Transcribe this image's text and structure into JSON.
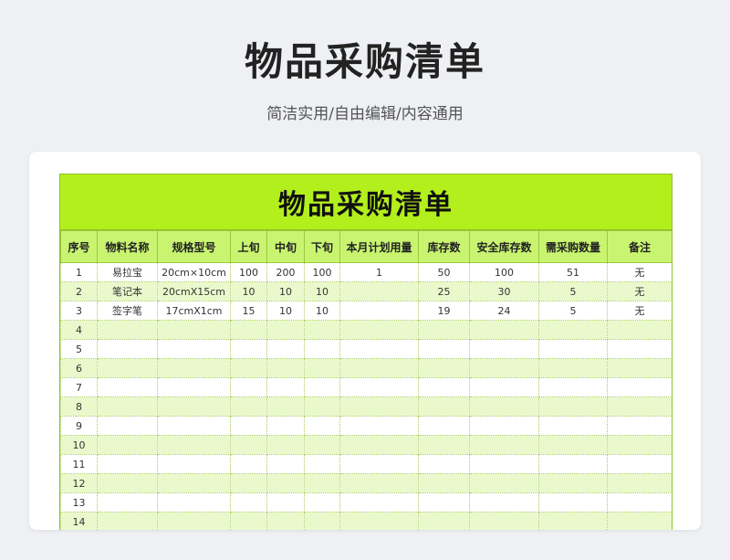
{
  "header": {
    "title": "物品采购清单",
    "subtitle": "简洁实用/自由编辑/内容通用"
  },
  "sheet": {
    "title": "物品采购清单",
    "columns": [
      "序号",
      "物料名称",
      "规格型号",
      "上旬",
      "中旬",
      "下旬",
      "本月计划用量",
      "库存数",
      "安全库存数",
      "需采购数量",
      "备注"
    ],
    "rows": [
      [
        "1",
        "易拉宝",
        "20cm×10cm",
        "100",
        "200",
        "100",
        "1",
        "50",
        "100",
        "51",
        "无"
      ],
      [
        "2",
        "笔记本",
        "20cmX15cm",
        "10",
        "10",
        "10",
        "",
        "25",
        "30",
        "5",
        "无"
      ],
      [
        "3",
        "签字笔",
        "17cmX1cm",
        "15",
        "10",
        "10",
        "",
        "19",
        "24",
        "5",
        "无"
      ],
      [
        "4",
        "",
        "",
        "",
        "",
        "",
        "",
        "",
        "",
        "",
        ""
      ],
      [
        "5",
        "",
        "",
        "",
        "",
        "",
        "",
        "",
        "",
        "",
        ""
      ],
      [
        "6",
        "",
        "",
        "",
        "",
        "",
        "",
        "",
        "",
        "",
        ""
      ],
      [
        "7",
        "",
        "",
        "",
        "",
        "",
        "",
        "",
        "",
        "",
        ""
      ],
      [
        "8",
        "",
        "",
        "",
        "",
        "",
        "",
        "",
        "",
        "",
        ""
      ],
      [
        "9",
        "",
        "",
        "",
        "",
        "",
        "",
        "",
        "",
        "",
        ""
      ],
      [
        "10",
        "",
        "",
        "",
        "",
        "",
        "",
        "",
        "",
        "",
        ""
      ],
      [
        "11",
        "",
        "",
        "",
        "",
        "",
        "",
        "",
        "",
        "",
        ""
      ],
      [
        "12",
        "",
        "",
        "",
        "",
        "",
        "",
        "",
        "",
        "",
        ""
      ],
      [
        "13",
        "",
        "",
        "",
        "",
        "",
        "",
        "",
        "",
        "",
        ""
      ],
      [
        "14",
        "",
        "",
        "",
        "",
        "",
        "",
        "",
        "",
        "",
        ""
      ]
    ]
  },
  "colors": {
    "title_band": "#b3ef1c",
    "header_row": "#c8f470",
    "stripe": "#eaf9cc"
  }
}
